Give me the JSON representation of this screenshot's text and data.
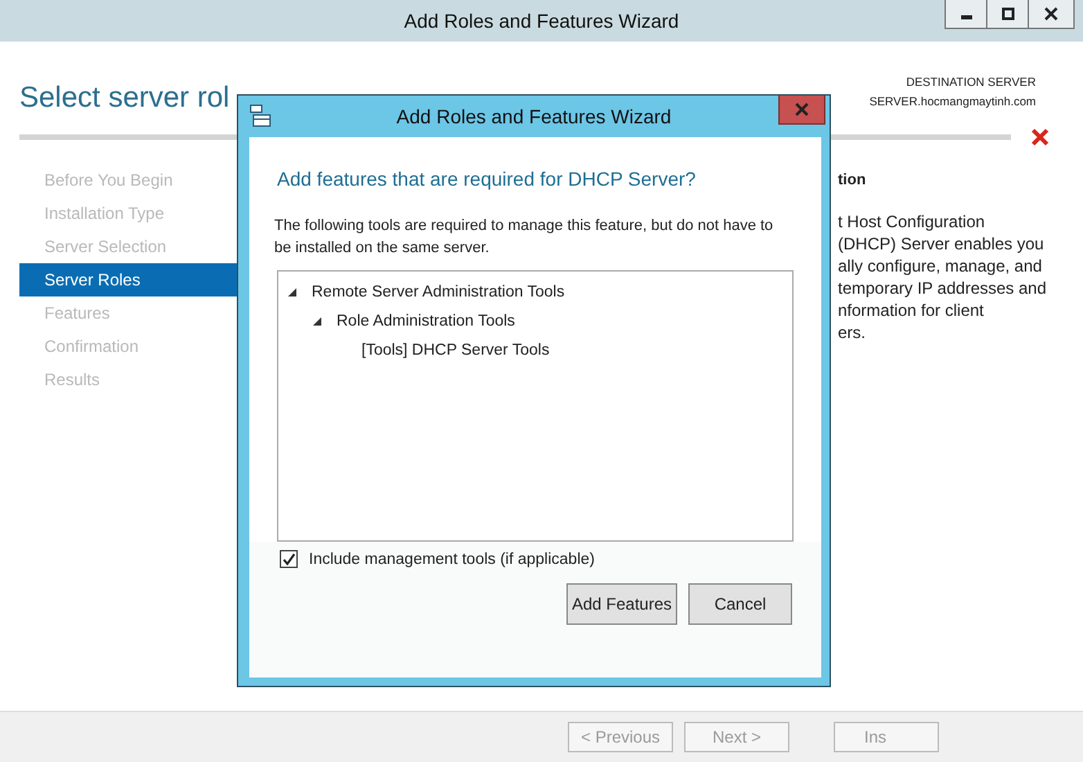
{
  "window": {
    "title": "Add Roles and Features Wizard"
  },
  "page_title": "Select server rol",
  "destination": {
    "label": "DESTINATION SERVER",
    "server": "SERVER.hocmangmaytinh.com"
  },
  "steps": [
    {
      "label": "Before You Begin",
      "selected": false
    },
    {
      "label": "Installation Type",
      "selected": false
    },
    {
      "label": "Server Selection",
      "selected": false
    },
    {
      "label": "Server Roles",
      "selected": true
    },
    {
      "label": "Features",
      "selected": false
    },
    {
      "label": "Confirmation",
      "selected": false
    },
    {
      "label": "Results",
      "selected": false
    }
  ],
  "description": {
    "heading": "tion",
    "lines": [
      "t Host Configuration",
      "(DHCP) Server enables you",
      "ally configure, manage, and",
      "temporary IP addresses and",
      "nformation for client",
      "ers."
    ]
  },
  "footer_buttons": [
    {
      "label": "< Previous",
      "disabled": true
    },
    {
      "label": "Next >",
      "disabled": true
    },
    {
      "label": "Ins",
      "disabled": true
    }
  ],
  "dialog": {
    "title": "Add Roles and Features Wizard",
    "heading": "Add features that are required for DHCP Server?",
    "message": "The following tools are required to manage this feature, but do not have to be installed on the same server.",
    "tree": [
      {
        "label": "Remote Server Administration Tools",
        "expanded": true,
        "children": [
          {
            "label": "Role Administration Tools",
            "expanded": true,
            "children": [
              {
                "label": "[Tools] DHCP Server Tools"
              }
            ]
          }
        ]
      }
    ],
    "include_tools": {
      "label": "Include management tools (if applicable)",
      "checked": true
    },
    "buttons": [
      "Add Features",
      "Cancel"
    ]
  }
}
